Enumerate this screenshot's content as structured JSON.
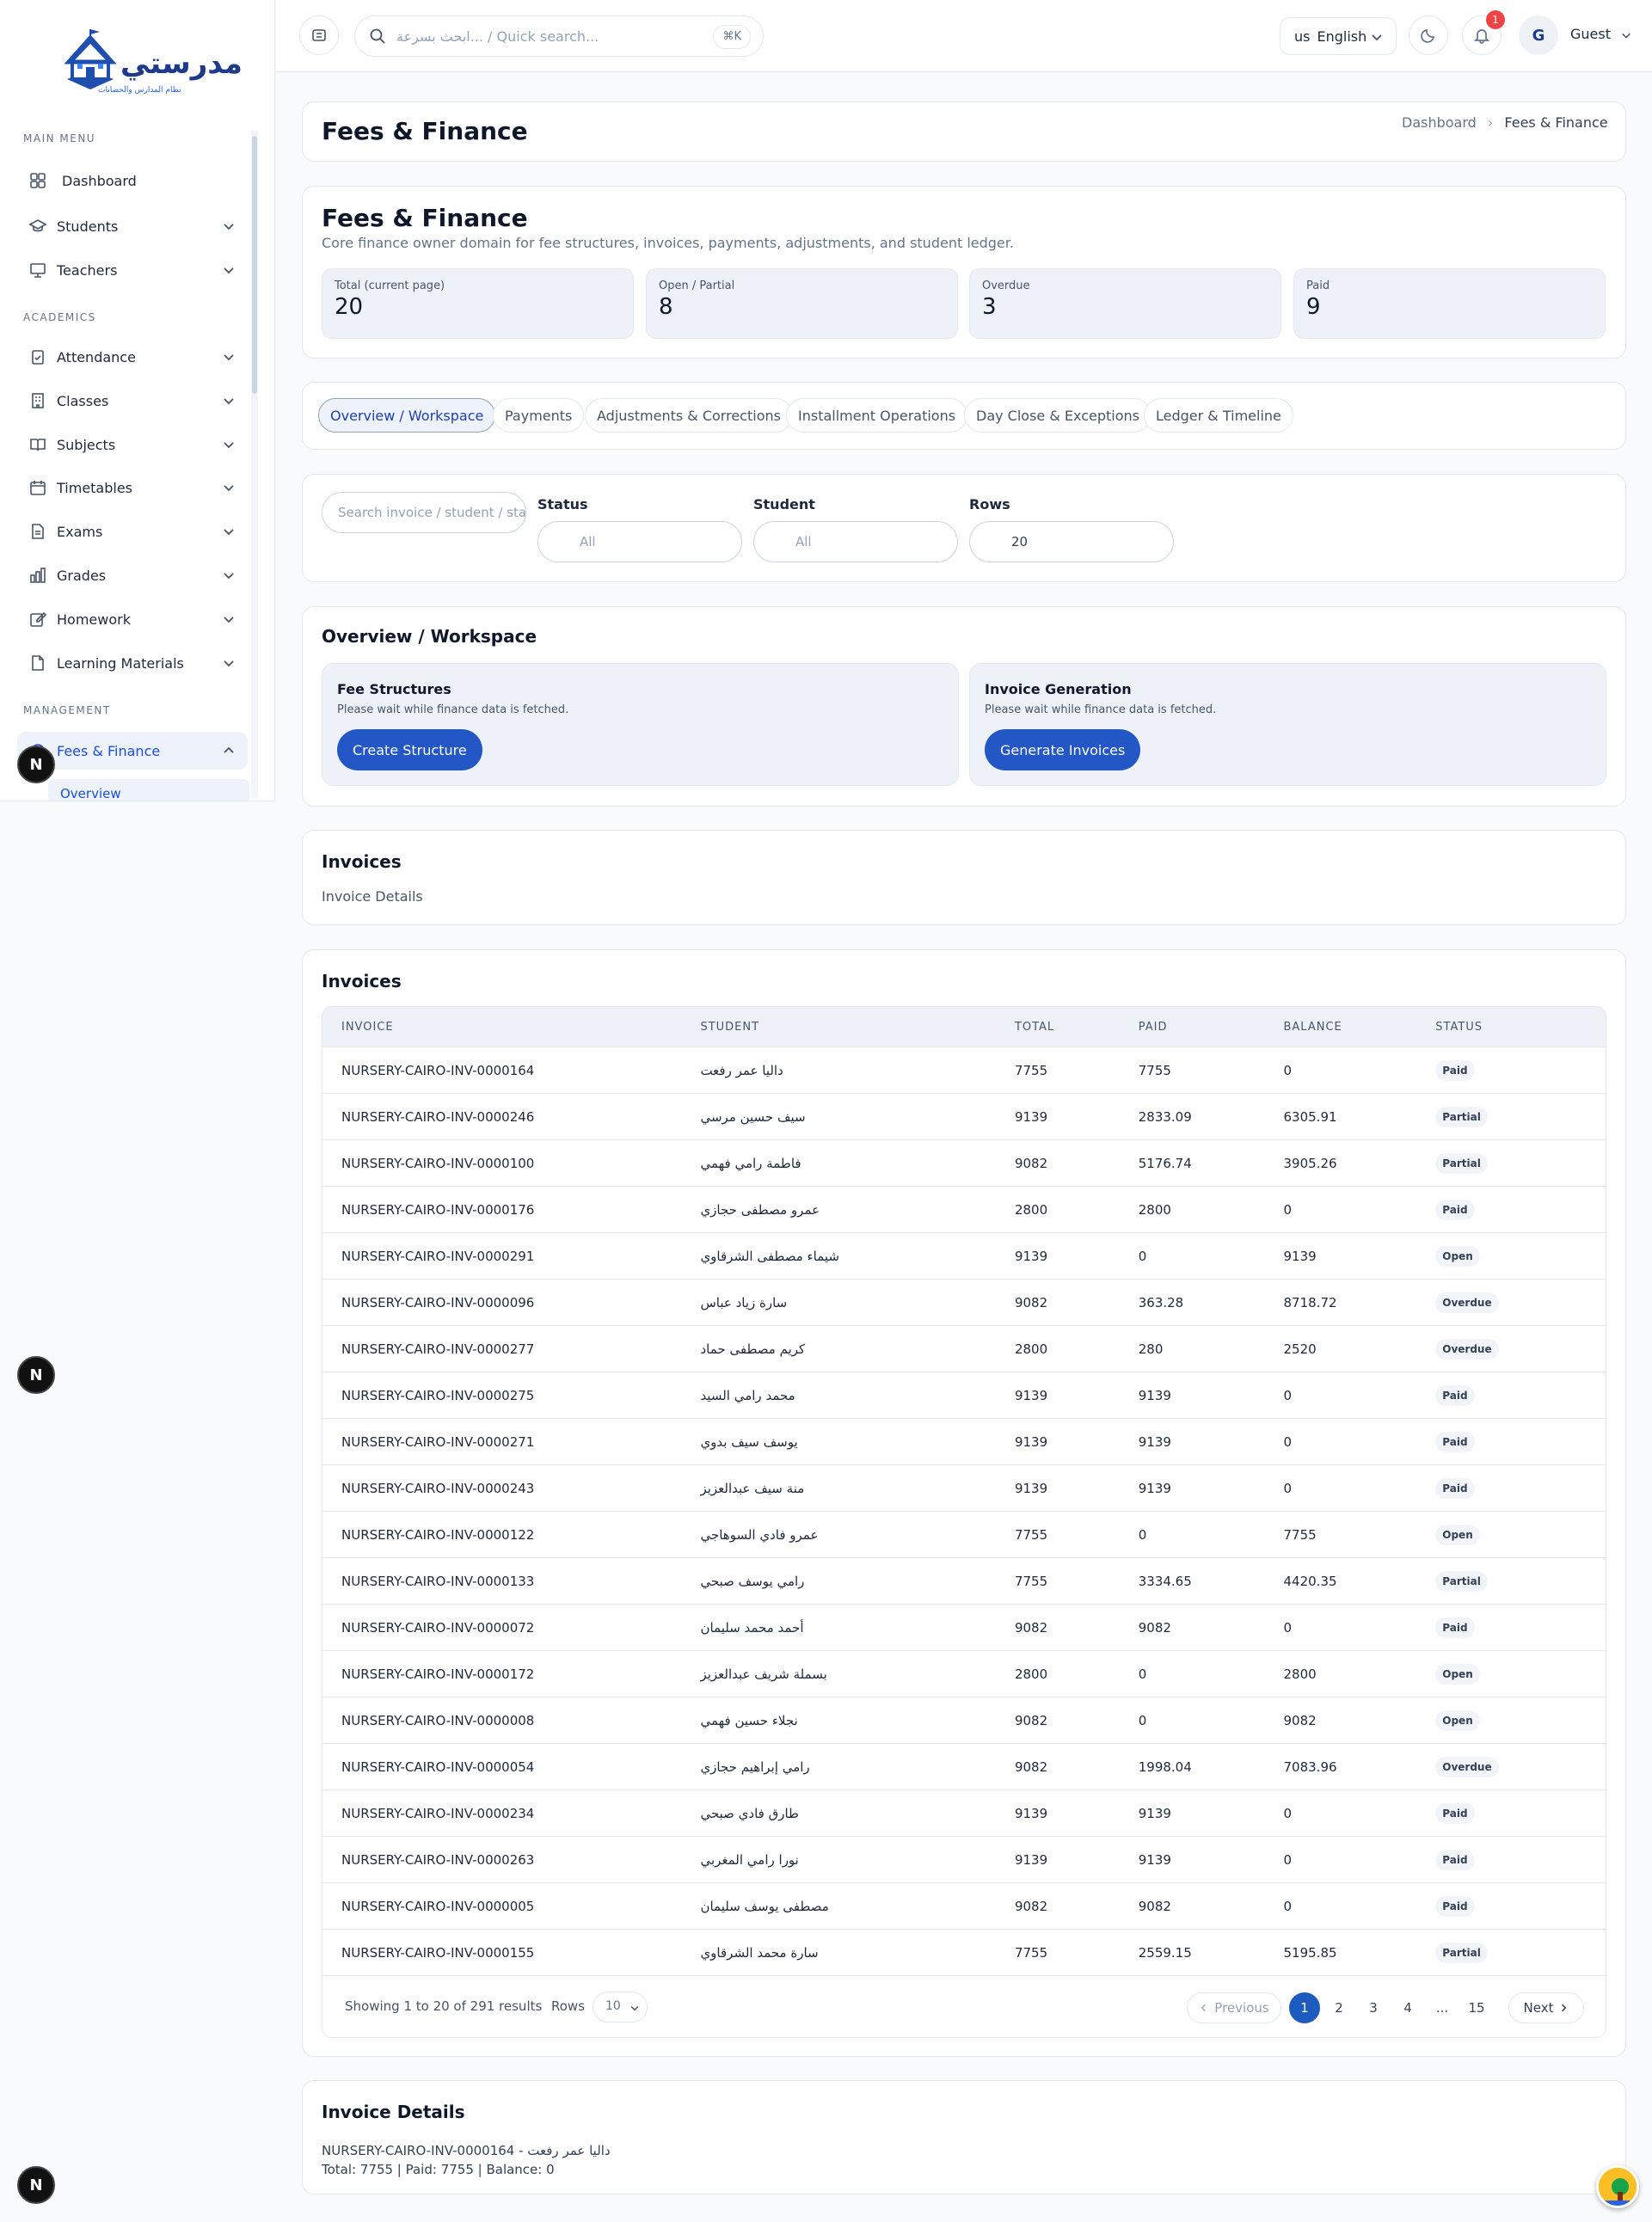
{
  "brand": {
    "name": "مدرستي",
    "tagline": "نظام المدارس والحضانات"
  },
  "sidebar": {
    "sections": {
      "main": "MAIN MENU",
      "academics": "ACADEMICS",
      "management": "MANAGEMENT"
    },
    "items": [
      {
        "label": "Dashboard",
        "icon": "grid-icon"
      },
      {
        "label": "Students",
        "icon": "graduation-cap-icon"
      },
      {
        "label": "Teachers",
        "icon": "presentation-icon"
      },
      {
        "label": "Attendance",
        "icon": "clipboard-check-icon"
      },
      {
        "label": "Classes",
        "icon": "building-icon"
      },
      {
        "label": "Subjects",
        "icon": "book-open-icon"
      },
      {
        "label": "Timetables",
        "icon": "calendar-icon"
      },
      {
        "label": "Exams",
        "icon": "file-text-icon"
      },
      {
        "label": "Grades",
        "icon": "bar-chart-icon"
      },
      {
        "label": "Homework",
        "icon": "edit-icon"
      },
      {
        "label": "Learning Materials",
        "icon": "file-icon"
      },
      {
        "label": "Fees & Finance",
        "icon": "wallet-icon"
      }
    ],
    "sub_active": "Overview"
  },
  "topbar": {
    "search_placeholder": "ابحث بسرعة... / Quick search...",
    "search_kbd": "⌘K",
    "lang_code": "us",
    "lang": "English",
    "notif_count": "1",
    "avatar_initial": "G",
    "user": "Guest"
  },
  "header": {
    "title": "Fees & Finance",
    "breadcrumb": [
      "Dashboard",
      "Fees & Finance"
    ]
  },
  "summary": {
    "title": "Fees & Finance",
    "subtitle": "Core finance owner domain for fee structures, invoices, payments, adjustments, and student ledger.",
    "stats": [
      {
        "label": "Total (current page)",
        "value": "20"
      },
      {
        "label": "Open / Partial",
        "value": "8"
      },
      {
        "label": "Overdue",
        "value": "3"
      },
      {
        "label": "Paid",
        "value": "9"
      }
    ]
  },
  "tabs": [
    "Overview / Workspace",
    "Payments",
    "Adjustments & Corrections",
    "Installment Operations",
    "Day Close & Exceptions",
    "Ledger & Timeline"
  ],
  "filters": {
    "search_placeholder": "Search invoice / student / status",
    "status_label": "Status",
    "status_value": "All",
    "student_label": "Student",
    "student_value": "All",
    "rows_label": "Rows",
    "rows_value": "20"
  },
  "workspace": {
    "title": "Overview / Workspace",
    "fee_structures": {
      "title": "Fee Structures",
      "note": "Please wait while finance data is fetched.",
      "button": "Create Structure"
    },
    "invoice_generation": {
      "title": "Invoice Generation",
      "note": "Please wait while finance data is fetched.",
      "button": "Generate Invoices"
    }
  },
  "invoices_small": {
    "title": "Invoices",
    "sub": "Invoice Details"
  },
  "invoices": {
    "title": "Invoices",
    "columns": [
      "INVOICE",
      "STUDENT",
      "TOTAL",
      "PAID",
      "BALANCE",
      "STATUS"
    ],
    "rows": [
      [
        "NURSERY-CAIRO-INV-0000164",
        "داليا عمر رفعت",
        "7755",
        "7755",
        "0",
        "Paid"
      ],
      [
        "NURSERY-CAIRO-INV-0000246",
        "سيف حسين مرسي",
        "9139",
        "2833.09",
        "6305.91",
        "Partial"
      ],
      [
        "NURSERY-CAIRO-INV-0000100",
        "فاطمة رامي فهمي",
        "9082",
        "5176.74",
        "3905.26",
        "Partial"
      ],
      [
        "NURSERY-CAIRO-INV-0000176",
        "عمرو مصطفى حجازي",
        "2800",
        "2800",
        "0",
        "Paid"
      ],
      [
        "NURSERY-CAIRO-INV-0000291",
        "شيماء مصطفى الشرقاوي",
        "9139",
        "0",
        "9139",
        "Open"
      ],
      [
        "NURSERY-CAIRO-INV-0000096",
        "سارة زياد عباس",
        "9082",
        "363.28",
        "8718.72",
        "Overdue"
      ],
      [
        "NURSERY-CAIRO-INV-0000277",
        "كريم مصطفى حماد",
        "2800",
        "280",
        "2520",
        "Overdue"
      ],
      [
        "NURSERY-CAIRO-INV-0000275",
        "محمد رامي السيد",
        "9139",
        "9139",
        "0",
        "Paid"
      ],
      [
        "NURSERY-CAIRO-INV-0000271",
        "يوسف سيف بدوي",
        "9139",
        "9139",
        "0",
        "Paid"
      ],
      [
        "NURSERY-CAIRO-INV-0000243",
        "منة سيف عبدالعزيز",
        "9139",
        "9139",
        "0",
        "Paid"
      ],
      [
        "NURSERY-CAIRO-INV-0000122",
        "عمرو فادي السوهاجي",
        "7755",
        "0",
        "7755",
        "Open"
      ],
      [
        "NURSERY-CAIRO-INV-0000133",
        "رامي يوسف صبحي",
        "7755",
        "3334.65",
        "4420.35",
        "Partial"
      ],
      [
        "NURSERY-CAIRO-INV-0000072",
        "أحمد محمد سليمان",
        "9082",
        "9082",
        "0",
        "Paid"
      ],
      [
        "NURSERY-CAIRO-INV-0000172",
        "بسملة شريف عبدالعزيز",
        "2800",
        "0",
        "2800",
        "Open"
      ],
      [
        "NURSERY-CAIRO-INV-0000008",
        "نجلاء حسين فهمي",
        "9082",
        "0",
        "9082",
        "Open"
      ],
      [
        "NURSERY-CAIRO-INV-0000054",
        "رامي إبراهيم حجازي",
        "9082",
        "1998.04",
        "7083.96",
        "Overdue"
      ],
      [
        "NURSERY-CAIRO-INV-0000234",
        "طارق فادي صبحي",
        "9139",
        "9139",
        "0",
        "Paid"
      ],
      [
        "NURSERY-CAIRO-INV-0000263",
        "نورا رامي المغربي",
        "9139",
        "9139",
        "0",
        "Paid"
      ],
      [
        "NURSERY-CAIRO-INV-0000005",
        "مصطفى يوسف سليمان",
        "9082",
        "9082",
        "0",
        "Paid"
      ],
      [
        "NURSERY-CAIRO-INV-0000155",
        "سارة محمد الشرقاوي",
        "7755",
        "2559.15",
        "5195.85",
        "Partial"
      ]
    ],
    "footer": {
      "showing": "Showing 1 to 20 of 291 results",
      "rows_label": "Rows",
      "rows_value": "10",
      "prev": "Previous",
      "next": "Next",
      "pages": [
        "1",
        "2",
        "3",
        "4",
        "...",
        "15"
      ]
    }
  },
  "details": {
    "title": "Invoice Details",
    "line1": "NURSERY-CAIRO-INV-0000164 - داليا عمر رفعت",
    "line2": "Total: 7755 | Paid: 7755 | Balance: 0"
  },
  "floating_badge": "N",
  "colors": {
    "primary": "#2357c6",
    "notif": "#ef4444",
    "accent_bg": "#eef2f8"
  }
}
